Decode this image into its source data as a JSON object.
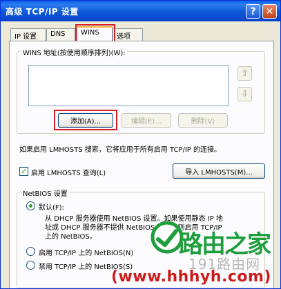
{
  "window": {
    "title": "高级 TCP/IP 设置",
    "help_label": "?",
    "close_label": "✕"
  },
  "tabs": [
    {
      "label": "IP 设置"
    },
    {
      "label": "DNS"
    },
    {
      "label": "WINS",
      "active": true
    },
    {
      "label": "选项"
    }
  ],
  "wins_group": {
    "legend": "WINS 地址(按使用顺序排列)(W):",
    "addresses": [],
    "up_arrow": "⇧",
    "down_arrow": "⇩",
    "add_label": "添加(A)...",
    "edit_label": "编辑(E)...",
    "remove_label": "删除(V)"
  },
  "lmhosts": {
    "description": "如果启用 LMHOSTS 搜索，它将应用于所有启用 TCP/IP 的连接。",
    "checkbox_label": "启用 LMHOSTS 查询(L)",
    "checked": true,
    "import_label": "导入 LMHOSTS(M)..."
  },
  "netbios": {
    "legend": "NetBIOS 设置",
    "options": [
      {
        "label": "默认(F):",
        "selected": true
      },
      {
        "label": "启用 TCP/IP 上的 NetBIOS(N)",
        "selected": false
      },
      {
        "label": "禁用 TCP/IP 上的 NetBIOS(S)",
        "selected": false
      }
    ],
    "default_desc_1": "从 DHCP 服务器使用 NetBIOS 设置。如果使用静态 IP 地",
    "default_desc_2": "址或 DHCP 服务器不提供 NetBIOS 设置，则启用 TCP/IP",
    "default_desc_3": "上的 NetBIOS。"
  },
  "watermark": {
    "brand_cn": "路由之家",
    "brand_num": "191路由网",
    "url": "(www.hhhyh.com)"
  },
  "colors": {
    "titlebar": "#0a5fe6",
    "dialog_bg": "#ece9d8",
    "highlight": "#d91f26",
    "watermark_green": "#1e9e3c",
    "watermark_red": "#cc1b1b"
  }
}
